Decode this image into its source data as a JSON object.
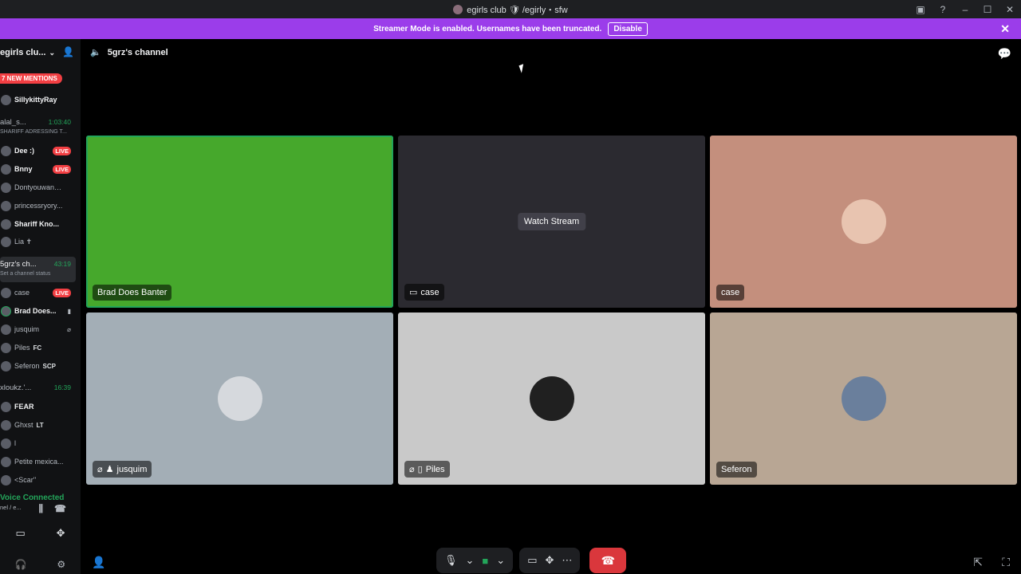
{
  "window": {
    "title": "egirls club 🛡 /egirly・sfw",
    "minimize": "–",
    "maximize": "☐",
    "close": "✕",
    "inbox": "▣",
    "help": "?"
  },
  "banner": {
    "text": "Streamer Mode is enabled. Usernames have been truncated.",
    "button": "Disable",
    "close": "✕"
  },
  "sidebar": {
    "server_name": "egirls clu...",
    "mentions": "7 NEW MENTIONS",
    "members_top": [
      {
        "name": "SillykittyRay",
        "live": ""
      },
      {
        "name": "Dee :)",
        "live": "LIVE"
      },
      {
        "name": "Bnny",
        "live": "LIVE"
      },
      {
        "name": "Dontyouwann...",
        "live": ""
      },
      {
        "name": "princessryory...",
        "live": ""
      },
      {
        "name": "Shariff Kno...",
        "live": ""
      },
      {
        "name": "Lia ✝",
        "live": ""
      }
    ],
    "channel1": {
      "name": "alal_s...",
      "time": "1:03:40",
      "sub": "SHARIFF ADRESSING T..."
    },
    "channel2": {
      "name": "5grz's ch...",
      "time": "43:19",
      "sub": "Set a channel status"
    },
    "members_voice": [
      {
        "name": "case",
        "extra": "LIVE"
      },
      {
        "name": "Brad Does...",
        "extra": ""
      },
      {
        "name": "jusquim",
        "extra": ""
      },
      {
        "name": "Piles",
        "extra": "FC"
      },
      {
        "name": "Seferon",
        "extra": "SCP"
      }
    ],
    "channel3": {
      "name": "xloukz.'...",
      "time": "16:39"
    },
    "members_bottom": [
      {
        "name": "FEAR"
      },
      {
        "name": "Ghxst",
        "extra": "LT"
      },
      {
        "name": "l"
      },
      {
        "name": "Petite mexica..."
      },
      {
        "name": "<Scar''"
      }
    ],
    "voice_connected": "Voice Connected",
    "voice_sub": "nel / e..."
  },
  "main": {
    "channel_name": "5grz's channel",
    "tiles": [
      {
        "label": "Brad Does Banter",
        "bg": "#46a82c"
      },
      {
        "label": "case",
        "bg": "#2b2a30",
        "watch": "Watch Stream"
      },
      {
        "label": "case",
        "bg": "#c48f7d"
      },
      {
        "label": "jusquim",
        "bg": "#a3aeb6"
      },
      {
        "label": "Piles",
        "bg": "#c9c9c9"
      },
      {
        "label": "Seferon",
        "bg": "#b8a694"
      }
    ]
  }
}
